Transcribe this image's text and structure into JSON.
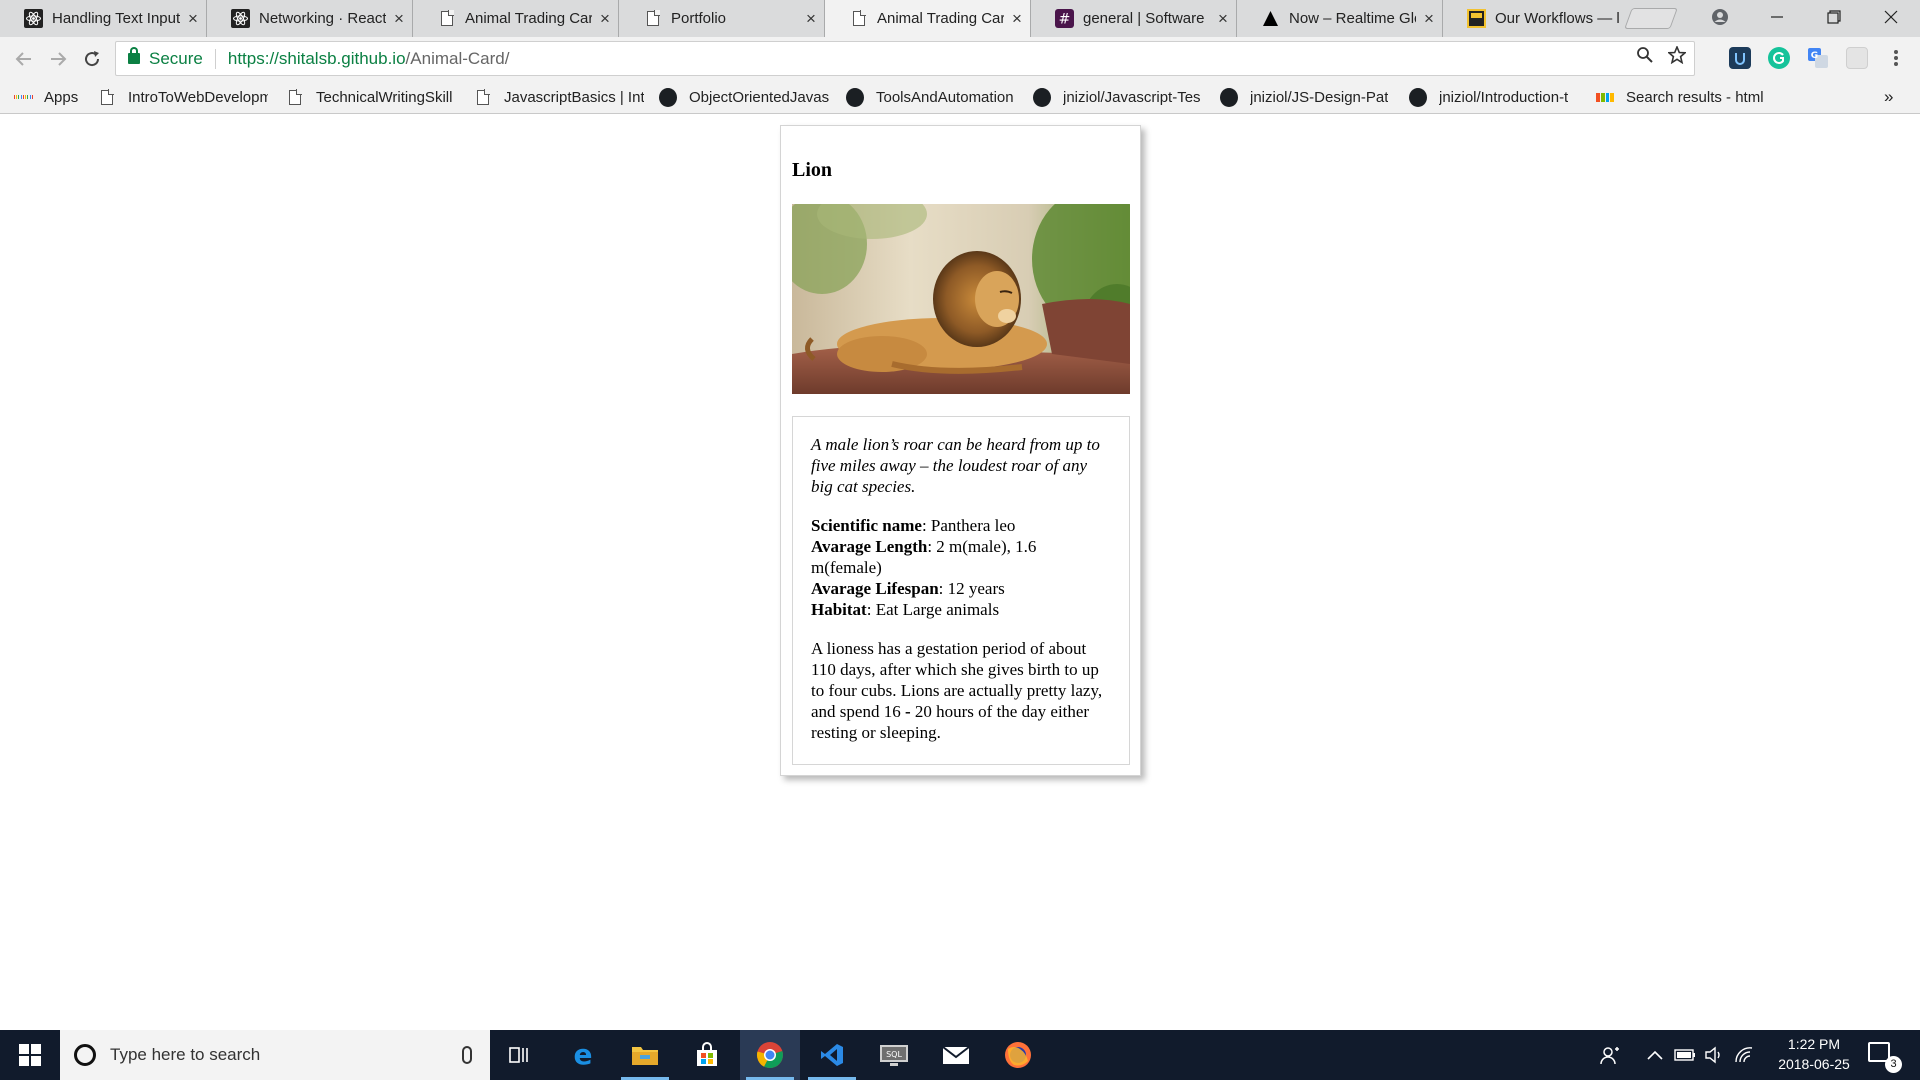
{
  "browser": {
    "tabs": [
      {
        "title": "Handling Text Input",
        "icon": "react-icon",
        "active": false
      },
      {
        "title": "Networking · React",
        "icon": "react-icon",
        "active": false
      },
      {
        "title": "Animal Trading Card",
        "icon": "page-icon",
        "active": false
      },
      {
        "title": "Portfolio",
        "icon": "page-icon",
        "active": false
      },
      {
        "title": "Animal Trading Card",
        "icon": "page-icon",
        "active": true
      },
      {
        "title": "general | Software",
        "icon": "slack-icon",
        "active": false
      },
      {
        "title": "Now – Realtime Glo",
        "icon": "now-icon",
        "active": false
      },
      {
        "title": "Our Workflows — l",
        "icon": "syntax-icon",
        "active": false
      }
    ],
    "close_glyph": "×",
    "address": {
      "secure_label": "Secure",
      "url_host": "https://shitalsb.github.io",
      "url_path": "/Animal-Card/"
    },
    "bookmarks": [
      {
        "label": "Apps",
        "icon": "apps-icon"
      },
      {
        "label": "IntroToWebDevelopm",
        "icon": "page-icon"
      },
      {
        "label": "TechnicalWritingSkill",
        "icon": "page-icon"
      },
      {
        "label": "JavascriptBasics | Intr",
        "icon": "page-icon"
      },
      {
        "label": "ObjectOrientedJavas",
        "icon": "github-icon"
      },
      {
        "label": "ToolsAndAutomation",
        "icon": "github-icon"
      },
      {
        "label": "jniziol/Javascript-Tes",
        "icon": "github-icon"
      },
      {
        "label": "jniziol/JS-Design-Pat",
        "icon": "github-icon"
      },
      {
        "label": "jniziol/Introduction-t",
        "icon": "github-icon"
      },
      {
        "label": "Search results - html",
        "icon": "microsoft-icon"
      }
    ],
    "overflow_glyph": "»"
  },
  "card": {
    "title": "Lion",
    "fact": "A male lion’s roar can be heard from up to five miles away – the loudest roar of any big cat species.",
    "details": [
      {
        "label": "Scientific name",
        "value": ": Panthera leo"
      },
      {
        "label": "Avarage Length",
        "value": ": 2 m(male), 1.6 m(female)"
      },
      {
        "label": "Avarage Lifespan",
        "value": ": 12 years"
      },
      {
        "label": "Habitat",
        "value": ": Eat Large animals"
      }
    ],
    "description_before": "A lioness has a gestation period of about 110 days, after which she gives birth to up to four cubs. Lions are actually pretty lazy, and spend 16 ",
    "description_bold": "-",
    "description_after": " 20 hours of the day either resting or sleeping."
  },
  "taskbar": {
    "search_placeholder": "Type here to search",
    "time": "1:22 PM",
    "date": "2018-06-25",
    "notification_count": "3"
  },
  "colors": {
    "secure_green": "#0b8043",
    "taskbar_bg": "#111b2c",
    "tab_strip": "#dadbdc"
  }
}
